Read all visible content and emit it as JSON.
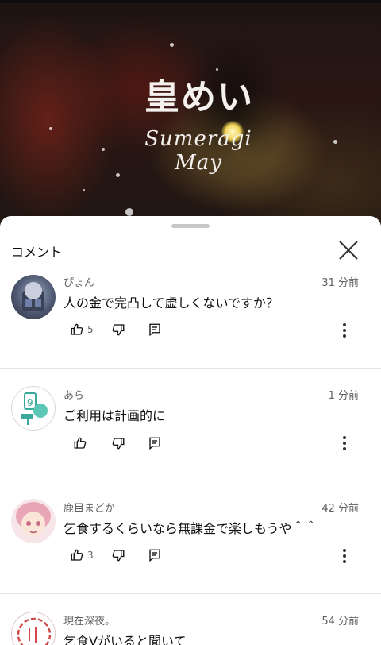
{
  "video": {
    "logo_jp": "皇めい",
    "logo_en": "Sumeragi May"
  },
  "sheet": {
    "title": "コメント"
  },
  "comments": [
    {
      "author": "ぴょん",
      "time": "31 分前",
      "text": "人の金で完凸して虚しくないですか？",
      "likes": "5"
    },
    {
      "author": "あら",
      "time": "1 分前",
      "text": "ご利用は計画的に",
      "likes": ""
    },
    {
      "author": "鹿目まどか",
      "time": "42 分前",
      "text": "乞食するくらいなら無課金で楽しもうや＾＾",
      "likes": "3"
    },
    {
      "author": "現在深夜。",
      "time": "54 分前",
      "text": "乞食Vがいると聞いて",
      "likes": ""
    }
  ],
  "icons": [
    "like-icon",
    "dislike-icon",
    "reply-icon",
    "more-vert-icon",
    "close-icon"
  ],
  "colors": {
    "sheet_bg": "#ffffff",
    "secondary_text": "#606060",
    "divider": "#e5e5e5"
  }
}
